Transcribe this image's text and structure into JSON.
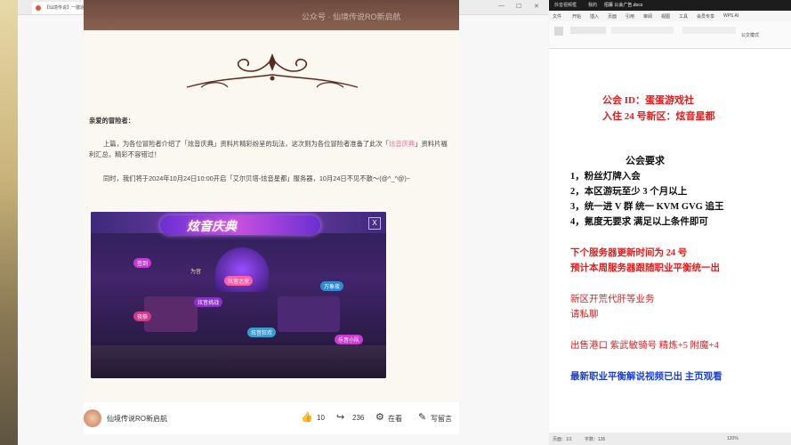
{
  "browser": {
    "tab_title": "【仙境传说】一键逐光 | 炫音",
    "min_icon": "minimize-icon",
    "max_icon": "maximize-icon",
    "close_icon": "close-icon"
  },
  "article": {
    "banner_watermark": "公众号 · 仙境传说RO新启航",
    "greeting": "亲爱的冒险者：",
    "para1_a": "上篇，为各位冒险者介绍了「炫音庆典」资料片精彩纷呈的玩法，这次则为各位冒险者准备了此次「",
    "para1_hl1": "炫音",
    "para1_hl2": "庆典",
    "para1_b": "」资料片福利汇总，精彩不容错过！",
    "para2": "同时，我们将于2024年10月24日10:00开启「艾尔贝塔-炫音星都」服务器，10月24日不见不散～",
    "para2_b": "(@^_^@)~",
    "game_title": "炫音庆典",
    "game_close": "X",
    "game_labels": [
      "签到",
      "炫音之旅",
      "为音",
      "炫音挑战",
      "万象夜",
      "夜祭",
      "炫音狂欢",
      "乐音小队"
    ]
  },
  "footer": {
    "account": "仙境传说RO新启航",
    "likes": "10",
    "shares": "236",
    "view_label": "在看",
    "comment_label": "写留言"
  },
  "word": {
    "tab1": "抖音视频框",
    "tab2": "我的",
    "tab3": "招募 公会广告.docx",
    "menu": [
      "文件",
      "开始",
      "插入",
      "页面",
      "引用",
      "审阅",
      "视图",
      "工具",
      "会员专享",
      "WPS AI"
    ],
    "ribbon_label": "公文模式",
    "line1": "公会 ID：蛋蛋游戏社",
    "line2": "入住 24 号新区：炫音星都",
    "req_title": "公会要求",
    "req": [
      "1，粉丝灯牌入会",
      "2，本区游玩至少 3 个月以上",
      "3，统一进 V 群  统一 KVM GVG  追王",
      "4，氪度无要求  满足以上条件即可"
    ],
    "update1": "下个服务器更新时间为 24 号",
    "update2": "预计本周服务器跟随职业平衡统一出",
    "service1": "新区开荒代肝等业务",
    "service2": "请私聊",
    "sale": "出售港口  紫武敏骑号  精炼+5  附魔+4",
    "video": "最新职业平衡解说视频已出  主页观看",
    "status_page": "页面：1/1",
    "status_words": "字数：136",
    "status_zoom": "120%"
  },
  "colors": {
    "red_text": "#e31b1b",
    "blue_text": "#1b3fd6",
    "highlight": "#e07a9b"
  }
}
